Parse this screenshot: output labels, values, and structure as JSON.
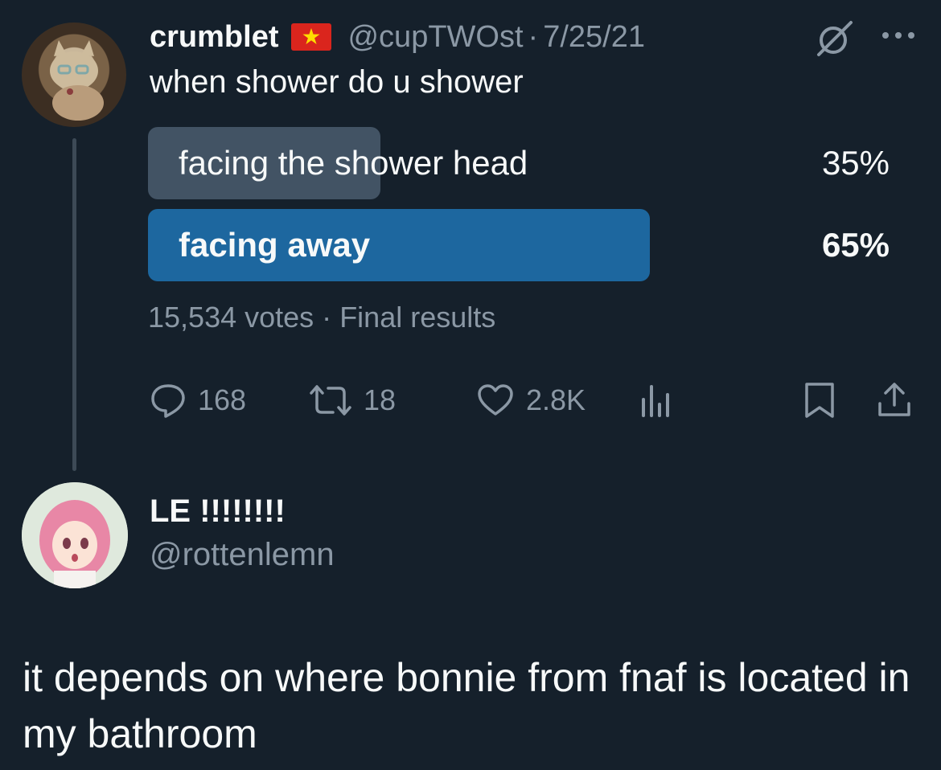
{
  "tweet": {
    "display_name": "crumblet",
    "flag_icon": "vietnam-flag-icon",
    "handle": "@cupTWOst",
    "separator": "·",
    "date": "7/25/21",
    "text": "when shower do u shower"
  },
  "poll": {
    "options": [
      {
        "label": "facing the shower head",
        "percent_text": "35%",
        "percent": 35,
        "winner": false,
        "color": "#425364"
      },
      {
        "label": "facing away",
        "percent_text": "65%",
        "percent": 65,
        "winner": true,
        "color": "#1d679f"
      }
    ],
    "votes": "15,534 votes",
    "separator": "·",
    "status": "Final results"
  },
  "actions": {
    "replies": "168",
    "retweets": "18",
    "likes": "2.8K"
  },
  "reply": {
    "display_name": "LE !!!!!!!!",
    "handle": "@rottenlemn",
    "text": "it depends on where bonnie from fnaf is located in my bathroom"
  },
  "colors": {
    "background": "#15202b",
    "text": "#f7f9f9",
    "muted": "#8b98a5"
  }
}
